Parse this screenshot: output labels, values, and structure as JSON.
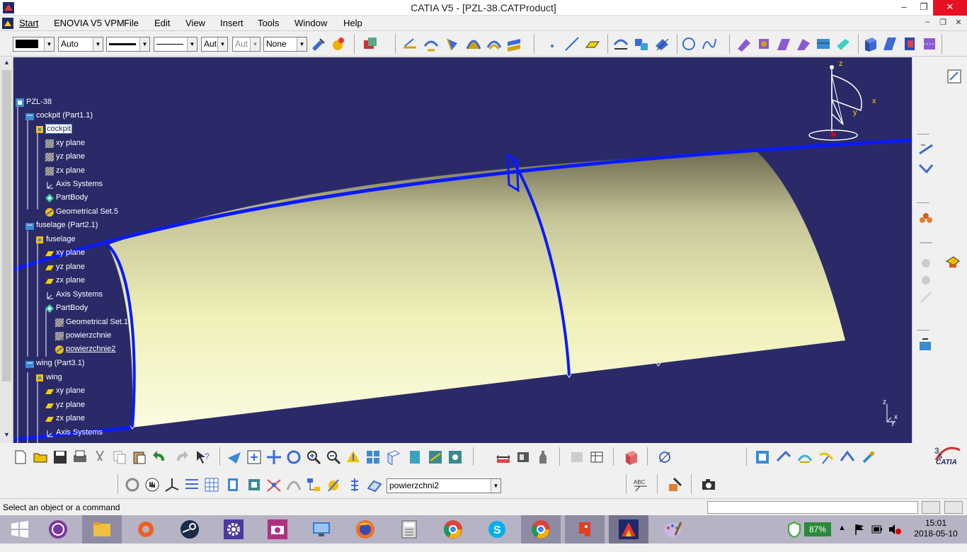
{
  "window": {
    "title": "CATIA V5 - [PZL-38.CATProduct]",
    "minimize": "–",
    "maximize": "❐",
    "close": "✕"
  },
  "menu": {
    "items": [
      "Start",
      "ENOVIA V5 VPM",
      "File",
      "Edit",
      "View",
      "Insert",
      "Tools",
      "Window",
      "Help"
    ],
    "mdi_min": "–",
    "mdi_restore": "❐",
    "mdi_close": "✕"
  },
  "toolbar_top": {
    "color_value": "",
    "transparency_value": "Auto",
    "linetype_value": "",
    "thickness_value": "",
    "point_style_value": "Aut",
    "layer_value": "Aut",
    "render_style_value": "None"
  },
  "tree": {
    "nodes": [
      {
        "label": "PZL-38"
      },
      {
        "label": "cockpit (Part1.1)"
      },
      {
        "label": "cockpit"
      },
      {
        "label": "xy plane"
      },
      {
        "label": "yz plane"
      },
      {
        "label": "zx plane"
      },
      {
        "label": "Axis Systems"
      },
      {
        "label": "PartBody"
      },
      {
        "label": "Geometrical Set.5"
      },
      {
        "label": "fuselage (Part2.1)"
      },
      {
        "label": "fuselage"
      },
      {
        "label": "xy plane"
      },
      {
        "label": "yz plane"
      },
      {
        "label": "zx plane"
      },
      {
        "label": "Axis Systems"
      },
      {
        "label": "PartBody"
      },
      {
        "label": "Geometrical Set.1"
      },
      {
        "label": "powierzchnie"
      },
      {
        "label": "powierzchnie2"
      },
      {
        "label": "wing (Part3.1)"
      },
      {
        "label": "wing"
      },
      {
        "label": "xy plane"
      },
      {
        "label": "yz plane"
      },
      {
        "label": "zx plane"
      },
      {
        "label": "Axis Systems"
      }
    ]
  },
  "compass": {
    "z": "z",
    "x": "x",
    "y": "y"
  },
  "axis_triad": {
    "z": "z",
    "x": "x",
    "y": "y"
  },
  "bottom_toolbar": {
    "current_set_value": "powierzchni2",
    "catia_logo": "CATIA"
  },
  "statusbar": {
    "message": "Select an object or a command",
    "command_value": ""
  },
  "taskbar": {
    "battery": "87%",
    "time": "15:01",
    "date": "2018-05-10"
  },
  "colors": {
    "viewport_bg": "#2b2a68",
    "surface": "#f0f0b8",
    "curve": "#0a1aff",
    "taskbar": "#b5b3c4"
  }
}
